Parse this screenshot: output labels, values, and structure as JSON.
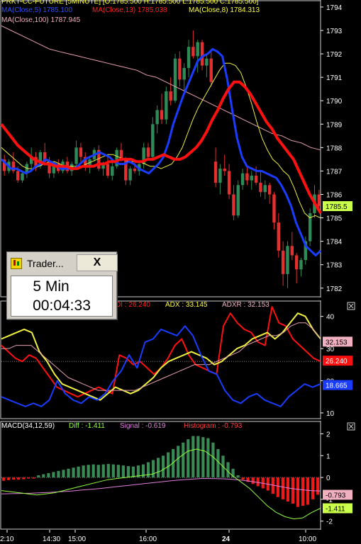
{
  "header": {
    "symbol_line": "PRKT-CC-FUTURE [5MINUTE]  [O:1785.500  H:1785.500  L:1785.500  C:1785.500]",
    "ma_line": [
      {
        "text": "MA(Close,5)  1785.100",
        "color": "#3050ff"
      },
      {
        "text": "MA(Close,13)  1785.038",
        "color": "#ff2020"
      },
      {
        "text": "MA(Close,8)  1784.313",
        "color": "#ffff40"
      }
    ],
    "ma100": {
      "text": "MA(Close,100)  1787.945",
      "color": "#f0b0c0"
    }
  },
  "timer": {
    "title": "Trader...",
    "close_label": "X",
    "name": "5 Min",
    "time": "00:04:33"
  },
  "dmi_header": [
    {
      "text": "DI : 26.240",
      "color": "#ff2020"
    },
    {
      "text": "ADX : 33.145",
      "color": "#ffff40"
    },
    {
      "text": "ADXR : 32.153",
      "color": "#f0b0c0"
    }
  ],
  "macd_header": [
    {
      "text": "MACD(34,12,59)",
      "color": "#ffffff"
    },
    {
      "text": "Diff : -1.411",
      "color": "#90ff40"
    },
    {
      "text": "Signal : -0.619",
      "color": "#e080e0"
    },
    {
      "text": "Histogram : -0.793",
      "color": "#ff4040"
    }
  ],
  "price_tags": {
    "last": "1785.5"
  },
  "dmi_tags": [
    "32.153",
    "26.240",
    "18.665"
  ],
  "macd_tags": [
    "-0.793",
    "-1.411"
  ],
  "time_labels": [
    "2:10",
    "14:30",
    "15:00",
    "16:00",
    "24",
    "10:00"
  ],
  "chart_data": [
    {
      "type": "candlestick",
      "title": "PRKT-CC-FUTURE [5MINUTE]",
      "ylim": [
        1781.6,
        1794.3
      ],
      "yticks": [
        1782,
        1783,
        1784,
        1785,
        1786,
        1787,
        1788,
        1789,
        1790,
        1791,
        1792,
        1793,
        1794
      ],
      "ohlc": [
        [
          1787.5,
          1787.7,
          1786.8,
          1787.0
        ],
        [
          1787.0,
          1787.5,
          1786.9,
          1787.4
        ],
        [
          1787.4,
          1787.8,
          1786.9,
          1787.0
        ],
        [
          1787.0,
          1787.2,
          1786.5,
          1786.6
        ],
        [
          1786.6,
          1787.0,
          1786.5,
          1786.9
        ],
        [
          1786.9,
          1787.4,
          1786.7,
          1787.3
        ],
        [
          1787.3,
          1788.0,
          1787.0,
          1787.6
        ],
        [
          1787.6,
          1787.8,
          1787.0,
          1787.2
        ],
        [
          1787.2,
          1787.9,
          1787.1,
          1787.8
        ],
        [
          1787.8,
          1788.2,
          1787.3,
          1787.4
        ],
        [
          1787.4,
          1787.6,
          1786.7,
          1786.9
        ],
        [
          1786.9,
          1787.4,
          1786.7,
          1787.3
        ],
        [
          1787.3,
          1787.5,
          1786.9,
          1787.0
        ],
        [
          1787.0,
          1787.5,
          1786.9,
          1787.4
        ],
        [
          1787.4,
          1787.6,
          1786.9,
          1787.0
        ],
        [
          1787.0,
          1787.4,
          1786.8,
          1787.3
        ],
        [
          1787.3,
          1788.3,
          1787.2,
          1788.0
        ],
        [
          1788.0,
          1788.2,
          1787.4,
          1787.6
        ],
        [
          1787.6,
          1787.8,
          1787.0,
          1787.2
        ],
        [
          1787.2,
          1787.6,
          1786.9,
          1787.5
        ],
        [
          1787.5,
          1788.0,
          1787.4,
          1787.9
        ],
        [
          1787.9,
          1788.1,
          1787.0,
          1787.1
        ],
        [
          1787.1,
          1787.4,
          1786.8,
          1787.3
        ],
        [
          1787.3,
          1787.6,
          1786.7,
          1786.8
        ],
        [
          1786.8,
          1787.4,
          1786.6,
          1787.2
        ],
        [
          1787.2,
          1788.0,
          1787.1,
          1787.9
        ],
        [
          1787.9,
          1788.2,
          1787.4,
          1787.5
        ],
        [
          1787.5,
          1787.6,
          1786.4,
          1786.6
        ],
        [
          1786.6,
          1787.2,
          1786.4,
          1787.1
        ],
        [
          1787.1,
          1787.4,
          1786.9,
          1787.0
        ],
        [
          1787.0,
          1787.4,
          1786.8,
          1787.3
        ],
        [
          1787.3,
          1788.2,
          1787.1,
          1788.0
        ],
        [
          1788.0,
          1788.2,
          1787.5,
          1787.6
        ],
        [
          1787.6,
          1789.3,
          1787.5,
          1789.0
        ],
        [
          1789.0,
          1789.8,
          1788.6,
          1789.6
        ],
        [
          1789.6,
          1790.3,
          1789.0,
          1789.2
        ],
        [
          1789.2,
          1790.6,
          1789.0,
          1790.4
        ],
        [
          1790.4,
          1791.0,
          1789.8,
          1790.0
        ],
        [
          1790.0,
          1792.0,
          1789.9,
          1791.8
        ],
        [
          1791.8,
          1792.1,
          1790.6,
          1790.9
        ],
        [
          1790.9,
          1791.6,
          1790.4,
          1791.4
        ],
        [
          1791.4,
          1792.6,
          1791.0,
          1792.3
        ],
        [
          1792.3,
          1793.0,
          1791.8,
          1791.9
        ],
        [
          1791.9,
          1792.6,
          1791.2,
          1792.5
        ],
        [
          1792.5,
          1792.6,
          1791.3,
          1791.5
        ],
        [
          1791.5,
          1792.0,
          1791.0,
          1791.8
        ],
        [
          1791.8,
          1792.2,
          1790.6,
          1790.8
        ],
        [
          1787.4,
          1788.0,
          1786.3,
          1786.5
        ],
        [
          1786.5,
          1787.3,
          1786.0,
          1787.1
        ],
        [
          1787.1,
          1787.7,
          1786.8,
          1787.0
        ],
        [
          1787.0,
          1787.3,
          1785.8,
          1786.0
        ],
        [
          1786.0,
          1786.4,
          1784.9,
          1785.1
        ],
        [
          1785.1,
          1786.6,
          1785.0,
          1786.4
        ],
        [
          1786.4,
          1787.1,
          1786.2,
          1786.9
        ],
        [
          1786.9,
          1787.2,
          1786.4,
          1786.6
        ],
        [
          1786.6,
          1787.0,
          1786.2,
          1786.8
        ],
        [
          1786.8,
          1787.2,
          1786.4,
          1786.5
        ],
        [
          1786.5,
          1787.0,
          1785.9,
          1786.1
        ],
        [
          1786.1,
          1786.6,
          1785.8,
          1786.4
        ],
        [
          1786.4,
          1786.5,
          1785.6,
          1786.0
        ],
        [
          1786.0,
          1786.1,
          1784.5,
          1784.8
        ],
        [
          1784.8,
          1785.2,
          1783.3,
          1783.6
        ],
        [
          1783.6,
          1784.0,
          1782.1,
          1782.6
        ],
        [
          1782.6,
          1784.0,
          1782.0,
          1783.8
        ],
        [
          1783.8,
          1784.4,
          1783.2,
          1783.4
        ],
        [
          1783.4,
          1783.5,
          1782.2,
          1782.8
        ],
        [
          1782.8,
          1783.3,
          1782.5,
          1783.2
        ],
        [
          1783.2,
          1784.2,
          1783.0,
          1784.0
        ],
        [
          1784.0,
          1785.4,
          1783.8,
          1785.2
        ],
        [
          1785.2,
          1786.4,
          1785.0,
          1786.0
        ],
        [
          1786.0,
          1786.2,
          1785.3,
          1785.5
        ]
      ],
      "series": [
        {
          "name": "MA(Close,5)",
          "color": "#1a3cff",
          "values": [
            1787.5,
            1787.3,
            1787.1,
            1787.1,
            1787.0,
            1786.9,
            1787.0,
            1787.2,
            1787.3,
            1787.5,
            1787.4,
            1787.3,
            1787.1,
            1787.1,
            1787.1,
            1787.1,
            1787.3,
            1787.5,
            1787.6,
            1787.7,
            1787.8,
            1787.7,
            1787.6,
            1787.4,
            1787.3,
            1787.3,
            1787.4,
            1787.3,
            1787.1,
            1787.0,
            1786.9,
            1787.1,
            1787.3,
            1787.6,
            1788.2,
            1789.0,
            1789.6,
            1790.2,
            1790.7,
            1791.2,
            1791.7,
            1791.9,
            1792.0,
            1792.2,
            1792.1,
            1791.9,
            1790.9,
            1789.6,
            1788.4,
            1787.6,
            1787.2,
            1787.1,
            1787.0,
            1787.0,
            1786.9,
            1786.8,
            1786.7,
            1786.4,
            1786.0,
            1785.5,
            1784.8,
            1784.3,
            1783.8,
            1783.6,
            1783.4,
            1783.6
          ]
        },
        {
          "name": "MA(Close,13)",
          "color": "#ff1010",
          "values": [
            1789.0,
            1788.7,
            1788.4,
            1788.1,
            1787.9,
            1787.7,
            1787.5,
            1787.4,
            1787.3,
            1787.3,
            1787.2,
            1787.2,
            1787.2,
            1787.1,
            1787.1,
            1787.2,
            1787.2,
            1787.2,
            1787.3,
            1787.3,
            1787.4,
            1787.4,
            1787.5,
            1787.5,
            1787.5,
            1787.4,
            1787.4,
            1787.5,
            1787.5,
            1787.6,
            1787.7,
            1787.6,
            1787.5,
            1787.5,
            1787.6,
            1787.8,
            1788.0,
            1788.3,
            1788.7,
            1789.2,
            1789.6,
            1790.1,
            1790.5,
            1790.8,
            1790.8,
            1790.6,
            1790.3,
            1789.9,
            1789.5,
            1789.1,
            1788.8,
            1788.4,
            1788.1,
            1787.8,
            1787.5,
            1787.0,
            1786.5,
            1786.0,
            1785.6,
            1785.2
          ]
        },
        {
          "name": "MA(Close,8)",
          "color": "#f0f040",
          "values": [
            1788.0,
            1787.8,
            1787.6,
            1787.4,
            1787.2,
            1787.1,
            1787.1,
            1787.2,
            1787.3,
            1787.4,
            1787.4,
            1787.3,
            1787.2,
            1787.2,
            1787.2,
            1787.2,
            1787.3,
            1787.4,
            1787.5,
            1787.6,
            1787.7,
            1787.7,
            1787.6,
            1787.5,
            1787.4,
            1787.4,
            1787.4,
            1787.3,
            1787.2,
            1787.2,
            1787.1,
            1787.2,
            1787.3,
            1787.6,
            1788.0,
            1788.6,
            1789.2,
            1789.7,
            1790.1,
            1790.5,
            1790.9,
            1791.3,
            1791.6,
            1791.6,
            1791.5,
            1791.2,
            1790.6,
            1789.9,
            1789.1,
            1788.4,
            1787.9,
            1787.5,
            1787.3,
            1787.0,
            1786.8,
            1786.3,
            1785.7,
            1785.2,
            1785.0,
            1785.1,
            1785.0
          ]
        },
        {
          "name": "MA(Close,100)",
          "color": "#e8a0b0",
          "values": [
            1793.2,
            1793.0,
            1792.8,
            1792.6,
            1792.4,
            1792.2,
            1792.1,
            1792.0,
            1791.9,
            1791.8,
            1791.7,
            1791.6,
            1791.5,
            1791.4,
            1791.3,
            1791.1,
            1791.0,
            1790.8,
            1790.6,
            1790.4,
            1790.2,
            1790.0,
            1789.8,
            1789.6,
            1789.4,
            1789.2,
            1789.0,
            1788.8,
            1788.6,
            1788.5,
            1788.3,
            1788.2,
            1788.0,
            1787.9
          ]
        }
      ]
    },
    {
      "type": "line",
      "title": "DMI",
      "ylim": [
        8,
        45
      ],
      "yticks": [
        10,
        20,
        30,
        40
      ],
      "series": [
        {
          "name": "DI",
          "color": "#ff1010",
          "values": [
            31,
            29,
            27,
            26,
            28,
            27,
            24,
            21,
            18,
            17,
            16,
            15,
            16,
            17,
            18,
            17,
            16,
            28,
            27,
            25,
            26,
            24,
            22,
            24,
            27,
            31,
            33,
            28,
            25,
            24,
            23,
            22,
            37,
            41,
            38,
            36,
            35,
            32,
            31,
            43,
            38,
            37,
            33,
            31,
            29,
            27,
            26
          ]
        },
        {
          "name": "ADX",
          "color": "#f0f040",
          "values": [
            33,
            34,
            35,
            36,
            35,
            29,
            26,
            22,
            19,
            18,
            17,
            16,
            15,
            14,
            16,
            18,
            17,
            16,
            17,
            19,
            21,
            24,
            26,
            27,
            28,
            29,
            28,
            27,
            25,
            26,
            28,
            30,
            31,
            33,
            34,
            35,
            33,
            35,
            38,
            41,
            40,
            36,
            33
          ]
        },
        {
          "name": "ADXR",
          "color": "#e8a0b0",
          "values": [
            30,
            30,
            31,
            31,
            31,
            29,
            27,
            25,
            23,
            21,
            20,
            19,
            18,
            17,
            17,
            17,
            17,
            17,
            17,
            18,
            19,
            20,
            21,
            22,
            23,
            24,
            25,
            25,
            25,
            26,
            27,
            28,
            29,
            31,
            32,
            33,
            34,
            34,
            35,
            37,
            38,
            38,
            36,
            33
          ]
        },
        {
          "name": "+DI",
          "color": "#1a3cff",
          "values": [
            15,
            14,
            13,
            12,
            13,
            12,
            14,
            20,
            16,
            14,
            13,
            15,
            14,
            16,
            20,
            23,
            28,
            24,
            32,
            33,
            36,
            35,
            34,
            37,
            34,
            28,
            23,
            22,
            17,
            14,
            13,
            15,
            16,
            14,
            13,
            12,
            15,
            17,
            19,
            18,
            19
          ]
        }
      ]
    },
    {
      "type": "bar",
      "title": "MACD(34,12,59)",
      "ylim": [
        -2.4,
        2.6
      ],
      "yticks": [
        2,
        1,
        0,
        -1,
        -2
      ],
      "histogram": [
        -0.15,
        -0.12,
        -0.1,
        -0.1,
        -0.08,
        -0.05,
        -0.05,
        0.1,
        0.15,
        0.2,
        0.25,
        0.3,
        0.35,
        0.4,
        0.45,
        0.5,
        0.55,
        0.58,
        0.6,
        0.58,
        0.6,
        0.62,
        0.6,
        0.58,
        0.55,
        0.52,
        0.5,
        0.55,
        0.6,
        0.7,
        0.8,
        0.9,
        1.0,
        1.15,
        1.3,
        1.45,
        1.6,
        1.75,
        1.9,
        1.9,
        1.85,
        1.8,
        1.6,
        1.3,
        1.0,
        0.7,
        0.4,
        0.1,
        -0.1,
        -0.2,
        -0.3,
        -0.4,
        -0.5,
        -0.6,
        -0.75,
        -0.9,
        -1.0,
        -1.1,
        -1.2,
        -1.35,
        -1.3,
        -1.25,
        -1.0,
        -0.79
      ],
      "series": [
        {
          "name": "Diff",
          "color": "#90ff40",
          "values": [
            -0.6,
            -0.65,
            -0.7,
            -0.75,
            -0.8,
            -0.75,
            -0.7,
            -0.6,
            -0.5,
            -0.4,
            -0.3,
            -0.2,
            -0.1,
            -0.05,
            0.0,
            0.05,
            0.1,
            0.15,
            0.3,
            0.55,
            0.9,
            1.2,
            1.3,
            1.2,
            0.9,
            0.5,
            0.1,
            -0.2,
            -0.5,
            -0.9,
            -1.3,
            -1.6,
            -1.8,
            -1.9,
            -1.85,
            -1.6,
            -1.41
          ]
        },
        {
          "name": "Signal",
          "color": "#e080e0",
          "values": [
            -0.75,
            -0.74,
            -0.73,
            -0.72,
            -0.7,
            -0.68,
            -0.65,
            -0.62,
            -0.58,
            -0.54,
            -0.5,
            -0.45,
            -0.4,
            -0.35,
            -0.3,
            -0.25,
            -0.2,
            -0.15,
            -0.11,
            -0.08,
            -0.05,
            -0.05,
            -0.06,
            -0.08,
            -0.12,
            -0.18,
            -0.25,
            -0.33,
            -0.42,
            -0.5,
            -0.56,
            -0.6,
            -0.62
          ]
        }
      ]
    }
  ]
}
